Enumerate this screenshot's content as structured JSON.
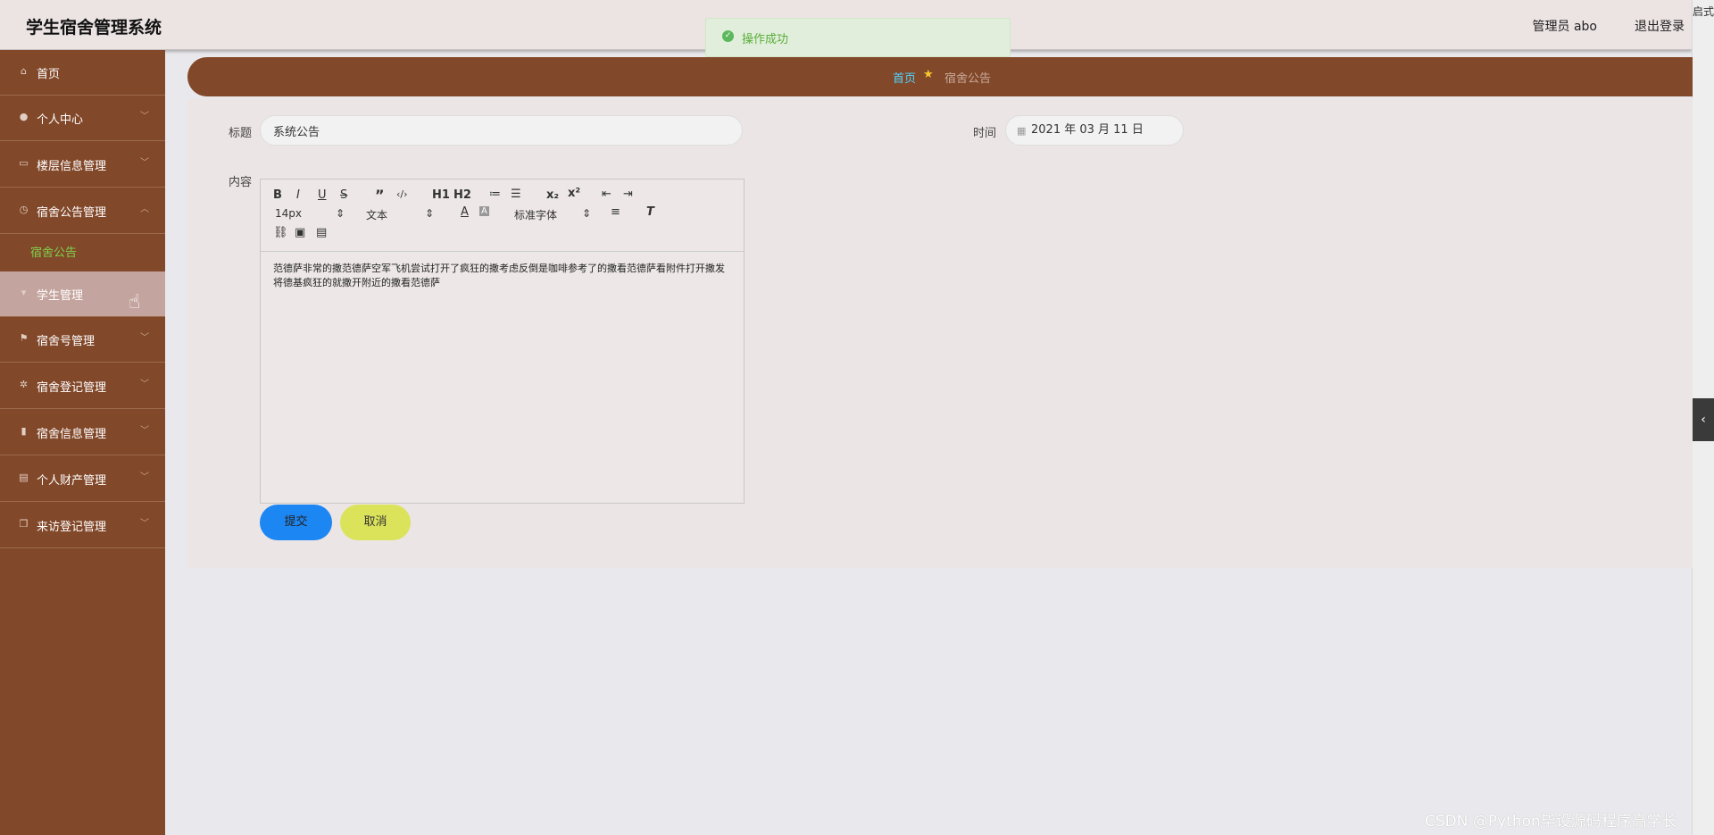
{
  "header": {
    "title": "学生宿舍管理系统",
    "user": "管理员 abo",
    "logout": "退出登录",
    "corner": "启式"
  },
  "toast": {
    "message": "操作成功"
  },
  "sidebar": {
    "items": [
      {
        "label": "首页",
        "icon": "home-icon"
      },
      {
        "label": "个人中心",
        "icon": "user-icon"
      },
      {
        "label": "楼层信息管理",
        "icon": "chat-icon"
      },
      {
        "label": "宿舍公告管理",
        "icon": "clock-icon"
      },
      {
        "label": "学生管理",
        "icon": "pin-icon"
      },
      {
        "label": "宿舍号管理",
        "icon": "flag-icon"
      },
      {
        "label": "宿舍登记管理",
        "icon": "gear-icon"
      },
      {
        "label": "宿舍信息管理",
        "icon": "bar-chart-icon"
      },
      {
        "label": "个人财产管理",
        "icon": "clipboard-icon"
      },
      {
        "label": "来访登记管理",
        "icon": "copy-icon"
      }
    ],
    "sub_item": "宿舍公告"
  },
  "breadcrumb": {
    "home": "首页",
    "current": "宿舍公告"
  },
  "form": {
    "title_label": "标题",
    "title_value": "系统公告",
    "time_label": "时间",
    "time_value": "2021 年 03 月 11 日",
    "content_label": "内容",
    "content_text": "范德萨非常的撒范德萨空军飞机尝试打开了疯狂的撒考虑反倒是咖啡参考了的撒看范德萨看附件打开撒发将德基疯狂的就撒开附近的撒看范德萨",
    "submit": "提交",
    "cancel": "取消"
  },
  "toolbar": {
    "size": "14px",
    "text_type": "文本",
    "font": "标准字体",
    "h1": "H1",
    "h2": "H2"
  },
  "watermark": "CSDN @Python毕设源码程序高学长"
}
